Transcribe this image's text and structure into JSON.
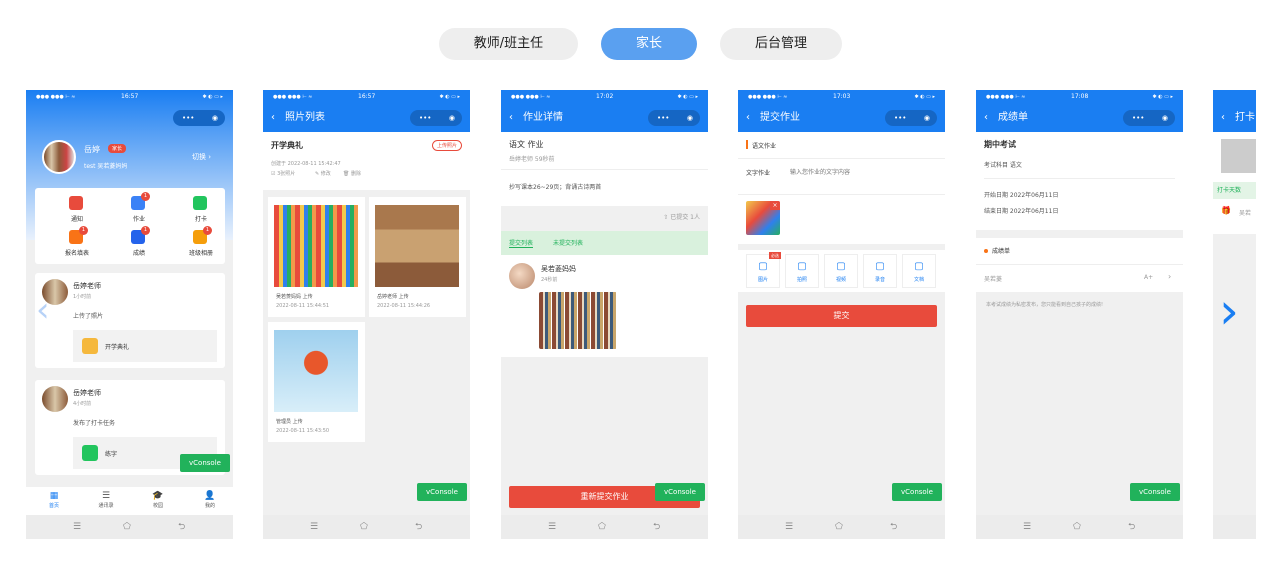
{
  "tabs": [
    "教师/班主任",
    "家长",
    "后台管理"
  ],
  "active_tab": 1,
  "common": {
    "status_left": "●●● ●●● ⊢ ≈",
    "status_right": "✱ ◐ ▭ ▸",
    "capsule_left": "•••",
    "capsule_right": "◉",
    "vconsole": "vConsole",
    "sys_menu": "☰",
    "sys_home": "⬠",
    "sys_back": "⮌"
  },
  "phone1": {
    "time": "16:57",
    "user_name": "岳婷",
    "user_badge": "家长",
    "user_sub": "test  吴若菱妈妈",
    "switch": "切换 ›",
    "grid": [
      {
        "label": "通知",
        "icon": "speaker-icon",
        "badge": "",
        "color": "#e84b3c"
      },
      {
        "label": "作业",
        "icon": "homework-icon",
        "badge": "1",
        "color": "#3b82f6"
      },
      {
        "label": "打卡",
        "icon": "checkin-icon",
        "badge": "",
        "color": "#22c55e"
      },
      {
        "label": "报名填表",
        "icon": "form-icon",
        "badge": "1",
        "color": "#f97316"
      },
      {
        "label": "成绩",
        "icon": "score-icon",
        "badge": "1",
        "color": "#2563eb"
      },
      {
        "label": "班级相册",
        "icon": "album-icon",
        "badge": "1",
        "color": "#f59e0b"
      }
    ],
    "feed": [
      {
        "name": "岳婷老师",
        "time": "1小时前",
        "text": "上传了照片",
        "item": "开学典礼"
      },
      {
        "name": "岳婷老师",
        "time": "4小时前",
        "text": "发布了打卡任务",
        "item": "练字"
      }
    ],
    "bottom_nav": [
      "首页",
      "通讯录",
      "校园",
      "我的"
    ]
  },
  "phone2": {
    "time": "16:57",
    "title": "照片列表",
    "album_title": "开学典礼",
    "upload_btn": "上传照片",
    "created": "创建于 2022-08-11 15:42:47",
    "actions": [
      "3张照片",
      "修改",
      "删除"
    ],
    "photos": [
      {
        "caption": "吴若菱妈妈 上传",
        "time": "2022-08-11 15:44:51",
        "kind": "pencils"
      },
      {
        "caption": "岳婷老师 上传",
        "time": "2022-08-11 15:44:26",
        "kind": "court"
      },
      {
        "caption": "管理员 上传",
        "time": "2022-08-11 15:43:50",
        "kind": "hoop"
      }
    ]
  },
  "phone3": {
    "time": "17:02",
    "title": "作业详情",
    "hw_title": "语文 作业",
    "hw_sub": "岳婷老师 59秒前",
    "hw_content": "抄写课本26~29页；背诵古诗两首",
    "submitted": "已提交 1人",
    "tab_a": "提交列表",
    "tab_b": "未提交列表",
    "submitter": "吴若菱妈妈",
    "submit_time": "24秒前",
    "resubmit": "重新提交作业"
  },
  "phone4": {
    "time": "17:03",
    "title": "提交作业",
    "section": "语文作业",
    "text_label": "文字作业",
    "text_placeholder": "输入您作业的文字内容",
    "tools": [
      {
        "label": "图片",
        "icon": "image-icon",
        "tag": "必选"
      },
      {
        "label": "拍照",
        "icon": "camera-icon",
        "tag": ""
      },
      {
        "label": "视频",
        "icon": "video-icon",
        "tag": ""
      },
      {
        "label": "录音",
        "icon": "mic-icon",
        "tag": ""
      },
      {
        "label": "文档",
        "icon": "file-icon",
        "tag": ""
      }
    ],
    "submit": "提交"
  },
  "phone5": {
    "time": "17:08",
    "title": "成绩单",
    "exam_title": "期中考试",
    "subject": "考试科目  语文",
    "start": "开始日期  2022年06月11日",
    "end": "结束日期  2022年06月11日",
    "section": "成绩单",
    "student": "吴若菱",
    "grade": "A+",
    "note": "本考试成绩为私密发布，您只能看到自己孩子的成绩!"
  },
  "phone6": {
    "title": "打卡",
    "days_btn": "打卡天数",
    "name": "吴若"
  },
  "arrows": {
    "left": "‹",
    "right": "›"
  }
}
